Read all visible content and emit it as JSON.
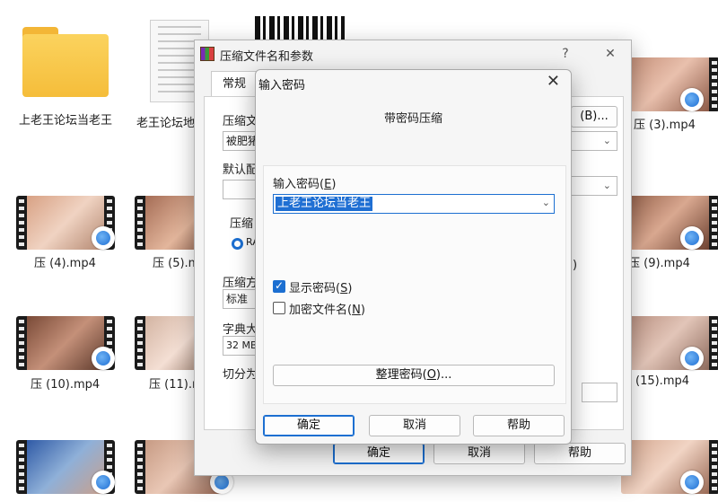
{
  "desktop": {
    "folder_label": "上老王论坛当老王",
    "doc_label": "老王论坛地",
    "videos": [
      {
        "label": "压 (4).mp4"
      },
      {
        "label": "压 (5).m"
      },
      {
        "label": "压 (10).mp4"
      },
      {
        "label": "压 (11).m"
      },
      {
        "label": "压 (3).mp4"
      },
      {
        "label": "压 (9).mp4"
      },
      {
        "label": "(15).mp4"
      }
    ]
  },
  "main_dialog": {
    "title": "压缩文件名和参数",
    "help_glyph": "?",
    "close_glyph": "✕",
    "tab_general": "常规",
    "label_archive": "压缩文",
    "archive_value": "被肥猪",
    "label_default": "默认配",
    "label_format": "压缩",
    "format_radio": "RA",
    "label_method": "压缩方",
    "method_value": "标准",
    "label_dict": "字典大",
    "dict_value": "32 MB",
    "label_split": "切分为",
    "browse_button": "(B)...",
    "right_radio_part": ")",
    "ok": "确定",
    "cancel": "取消",
    "help": "帮助"
  },
  "password_dialog": {
    "title": "输入密码",
    "close_glyph": "✕",
    "heading": "带密码压缩",
    "label_password": "输入密码",
    "label_password_key": "E",
    "password_value": "上老王论坛当老王",
    "show_password": "显示密码",
    "show_password_key": "S",
    "show_password_checked": true,
    "encrypt_names": "加密文件名",
    "encrypt_names_key": "N",
    "encrypt_names_checked": false,
    "organize_button": "整理密码",
    "organize_key": "O",
    "organize_suffix": "...",
    "ok": "确定",
    "cancel": "取消",
    "help": "帮助"
  }
}
